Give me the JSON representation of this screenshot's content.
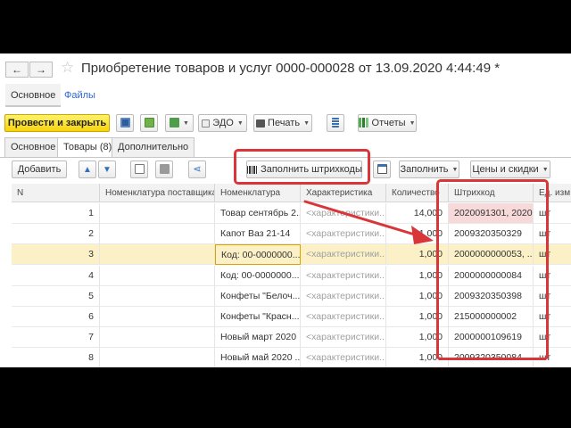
{
  "nav": {
    "back": "←",
    "forward": "→"
  },
  "title": "Приобретение товаров и услуг 0000-000028 от 13.09.2020 4:44:49 *",
  "sections": {
    "main": "Основное",
    "files": "Файлы"
  },
  "toolbar": {
    "post_close": "Провести и закрыть",
    "edo": "ЭДО",
    "print": "Печать",
    "reports": "Отчеты"
  },
  "tabs": {
    "main": "Основное",
    "goods": "Товары (8)",
    "additional": "Дополнительно"
  },
  "table_toolbar": {
    "add": "Добавить",
    "fill_barcodes": "Заполнить штрихкоды",
    "fill": "Заполнить",
    "prices": "Цены и скидки"
  },
  "columns": [
    "N",
    "Номенклатура поставщика",
    "Номенклатура",
    "Характеристика",
    "Количество",
    "Штрихкод",
    "Ед. изм."
  ],
  "rows": [
    {
      "n": "1",
      "supplier": "",
      "item": "Товар сентябрь 2...",
      "char": "<характеристики...",
      "qty": "14,000",
      "barcode": "2020091301, 2020...",
      "unit": "шт"
    },
    {
      "n": "2",
      "supplier": "",
      "item": "Капот Ваз 21-14",
      "char": "<характеристики...",
      "qty": "1,000",
      "barcode": "2009320350329",
      "unit": "шт"
    },
    {
      "n": "3",
      "supplier": "",
      "item": "Код: 00-0000000...",
      "char": "<характеристики...",
      "qty": "1,000",
      "barcode": "2000000000053, ...",
      "unit": "шт"
    },
    {
      "n": "4",
      "supplier": "",
      "item": "Код: 00-0000000...",
      "char": "<характеристики...",
      "qty": "1,000",
      "barcode": "2000000000084",
      "unit": "шт"
    },
    {
      "n": "5",
      "supplier": "",
      "item": "Конфеты \"Белоч...",
      "char": "<характеристики...",
      "qty": "1,000",
      "barcode": "2009320350398",
      "unit": "шт"
    },
    {
      "n": "6",
      "supplier": "",
      "item": "Конфеты \"Красн...",
      "char": "<характеристики...",
      "qty": "1,000",
      "barcode": "215000000002",
      "unit": "шт"
    },
    {
      "n": "7",
      "supplier": "",
      "item": "Новый март 2020",
      "char": "<характеристики...",
      "qty": "1,000",
      "barcode": "2000000109619",
      "unit": "шт"
    },
    {
      "n": "8",
      "supplier": "",
      "item": "Новый май 2020 ...",
      "char": "<характеристики...",
      "qty": "1,000",
      "barcode": "2009320350084",
      "unit": "шт"
    }
  ],
  "colors": {
    "accent_yellow": "#f7d30c",
    "annotation_red": "#d9363a",
    "link_blue": "#3366cc",
    "selected_row": "#fbf0c6"
  }
}
